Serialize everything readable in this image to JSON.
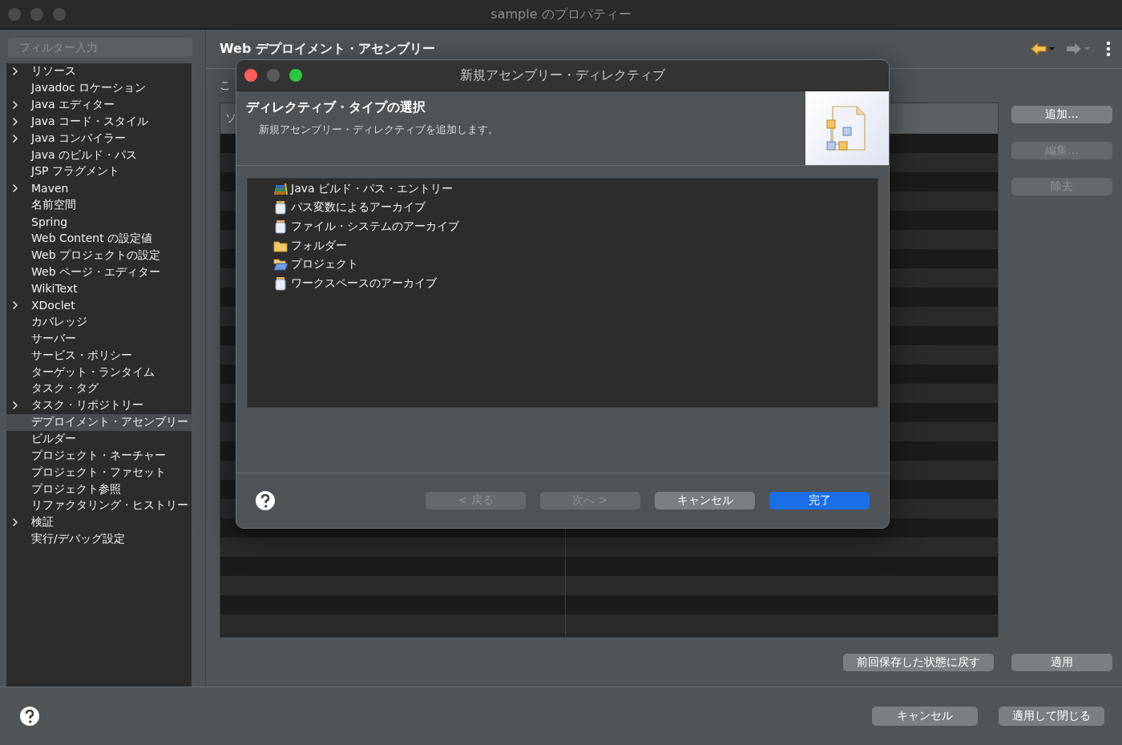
{
  "window": {
    "title": "sample のプロパティー"
  },
  "sidebar": {
    "filter": {
      "placeholder": "フィルター入力"
    },
    "items": [
      {
        "label": "リソース",
        "expandable": true,
        "selected": false
      },
      {
        "label": "Javadoc ロケーション",
        "expandable": false,
        "selected": false
      },
      {
        "label": "Java エディター",
        "expandable": true,
        "selected": false
      },
      {
        "label": "Java コード・スタイル",
        "expandable": true,
        "selected": false
      },
      {
        "label": "Java コンパイラー",
        "expandable": true,
        "selected": false
      },
      {
        "label": "Java のビルド・パス",
        "expandable": false,
        "selected": false
      },
      {
        "label": "JSP フラグメント",
        "expandable": false,
        "selected": false
      },
      {
        "label": "Maven",
        "expandable": true,
        "selected": false
      },
      {
        "label": "名前空間",
        "expandable": false,
        "selected": false
      },
      {
        "label": "Spring",
        "expandable": false,
        "selected": false
      },
      {
        "label": "Web Content の設定値",
        "expandable": false,
        "selected": false
      },
      {
        "label": "Web プロジェクトの設定",
        "expandable": false,
        "selected": false
      },
      {
        "label": "Web ページ・エディター",
        "expandable": false,
        "selected": false
      },
      {
        "label": "WikiText",
        "expandable": false,
        "selected": false
      },
      {
        "label": "XDoclet",
        "expandable": true,
        "selected": false
      },
      {
        "label": "カバレッジ",
        "expandable": false,
        "selected": false
      },
      {
        "label": "サーバー",
        "expandable": false,
        "selected": false
      },
      {
        "label": "サービス・ポリシー",
        "expandable": false,
        "selected": false
      },
      {
        "label": "ターゲット・ランタイム",
        "expandable": false,
        "selected": false
      },
      {
        "label": "タスク・タグ",
        "expandable": false,
        "selected": false
      },
      {
        "label": "タスク・リポジトリー",
        "expandable": true,
        "selected": false
      },
      {
        "label": "デプロイメント・アセンブリー",
        "expandable": false,
        "selected": true
      },
      {
        "label": "ビルダー",
        "expandable": false,
        "selected": false
      },
      {
        "label": "プロジェクト・ネーチャー",
        "expandable": false,
        "selected": false
      },
      {
        "label": "プロジェクト・ファセット",
        "expandable": false,
        "selected": false
      },
      {
        "label": "プロジェクト参照",
        "expandable": false,
        "selected": false
      },
      {
        "label": "リファクタリング・ヒストリー",
        "expandable": false,
        "selected": false
      },
      {
        "label": "検証",
        "expandable": true,
        "selected": false
      },
      {
        "label": "実行/デバッグ設定",
        "expandable": false,
        "selected": false
      }
    ]
  },
  "page": {
    "title": "Web デプロイメント・アセンブリー",
    "description_partial": "こ",
    "table": {
      "column_1_partial": "ソ"
    },
    "side_buttons": [
      {
        "label": "追加...",
        "disabled": false
      },
      {
        "label": "編集...",
        "disabled": true
      },
      {
        "label": "除去",
        "disabled": true
      }
    ],
    "footer_buttons": [
      {
        "label": "前回保存した状態に戻す"
      },
      {
        "label": "適用"
      }
    ]
  },
  "bottom_buttons": [
    {
      "label": "キャンセル"
    },
    {
      "label": "適用して閉じる"
    }
  ],
  "dialog": {
    "title": "新規アセンブリー・ディレクティブ",
    "heading": "ディレクティブ・タイプの選択",
    "subtitle": "新規アセンブリー・ディレクティブを追加します。",
    "items": [
      {
        "label": "Java ビルド・パス・エントリー",
        "kind": "library"
      },
      {
        "label": "パス変数によるアーカイブ",
        "kind": "jar"
      },
      {
        "label": "ファイル・システムのアーカイブ",
        "kind": "jar"
      },
      {
        "label": "フォルダー",
        "kind": "folder"
      },
      {
        "label": "プロジェクト",
        "kind": "project"
      },
      {
        "label": "ワークスペースのアーカイブ",
        "kind": "jar"
      }
    ],
    "buttons": [
      {
        "label": "< 戻る",
        "disabled": true,
        "default": false
      },
      {
        "label": "次へ >",
        "disabled": true,
        "default": false
      },
      {
        "label": "キャンセル",
        "disabled": false,
        "default": false
      },
      {
        "label": "完了",
        "disabled": false,
        "default": true
      }
    ]
  }
}
